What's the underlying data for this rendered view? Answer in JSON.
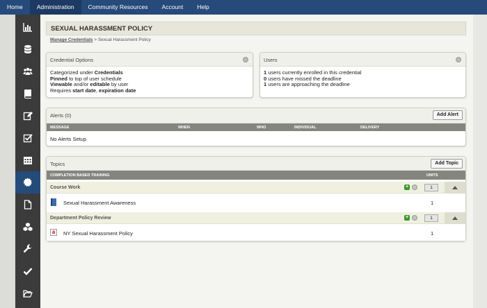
{
  "topnav": {
    "items": [
      "Home",
      "Administration",
      "Community Resources",
      "Account",
      "Help"
    ]
  },
  "sidebar": {
    "icons": [
      "bar-chart-icon",
      "database-icon",
      "users-icon",
      "book-icon",
      "edit-icon",
      "checkbox-icon",
      "calendar-icon",
      "gear-icon",
      "document-icon",
      "cubes-icon",
      "wrench-icon",
      "check-icon",
      "folder-open-icon"
    ],
    "active_index": 7
  },
  "page": {
    "title": "SEXUAL HARASSMENT POLICY",
    "breadcrumb_link": "Manage Credentials",
    "breadcrumb_rest": " > Sexual Harassment Policy"
  },
  "credential_options": {
    "title": "Credential Options",
    "line1_prefix": "Categorized under ",
    "line1_bold": "Credentials",
    "line2_bold": "Pinned",
    "line2_rest": " to top of user schedule",
    "line3_bold1": "Viewable",
    "line3_mid": " and/or ",
    "line3_bold2": "editable",
    "line3_rest": " by user",
    "line4_prefix": "Requires ",
    "line4_bold1": "start date",
    "line4_mid": ", ",
    "line4_bold2": "expiration date"
  },
  "users": {
    "title": "Users",
    "rows": [
      {
        "count": "1",
        "text": " users currently enrolled in this credential"
      },
      {
        "count": "0",
        "text": " users have missed the deadline"
      },
      {
        "count": "1",
        "text": " users are approaching the deadline"
      }
    ]
  },
  "alerts": {
    "title": "Alerts (0)",
    "add_label": "Add Alert",
    "columns": [
      "MESSAGE",
      "WHEN",
      "WHO",
      "INDIVIDUAL",
      "DELIVERY"
    ],
    "empty_text": "No Alerts Setup"
  },
  "topics": {
    "title": "Topics",
    "add_label": "Add Topic",
    "col_training": "COMPLETION BASED TRAINING",
    "col_units": "UNITS",
    "sections": [
      {
        "label": "Course Work",
        "units": "1",
        "item_label": "Sexual Harassment Awareness",
        "item_units": "1",
        "item_icon": "book-icon"
      },
      {
        "label": "Department Policy Review",
        "units": "1",
        "item_label": "NY Sexual Harassment Policy",
        "item_units": "1",
        "item_icon": "pdf-icon"
      }
    ]
  }
}
